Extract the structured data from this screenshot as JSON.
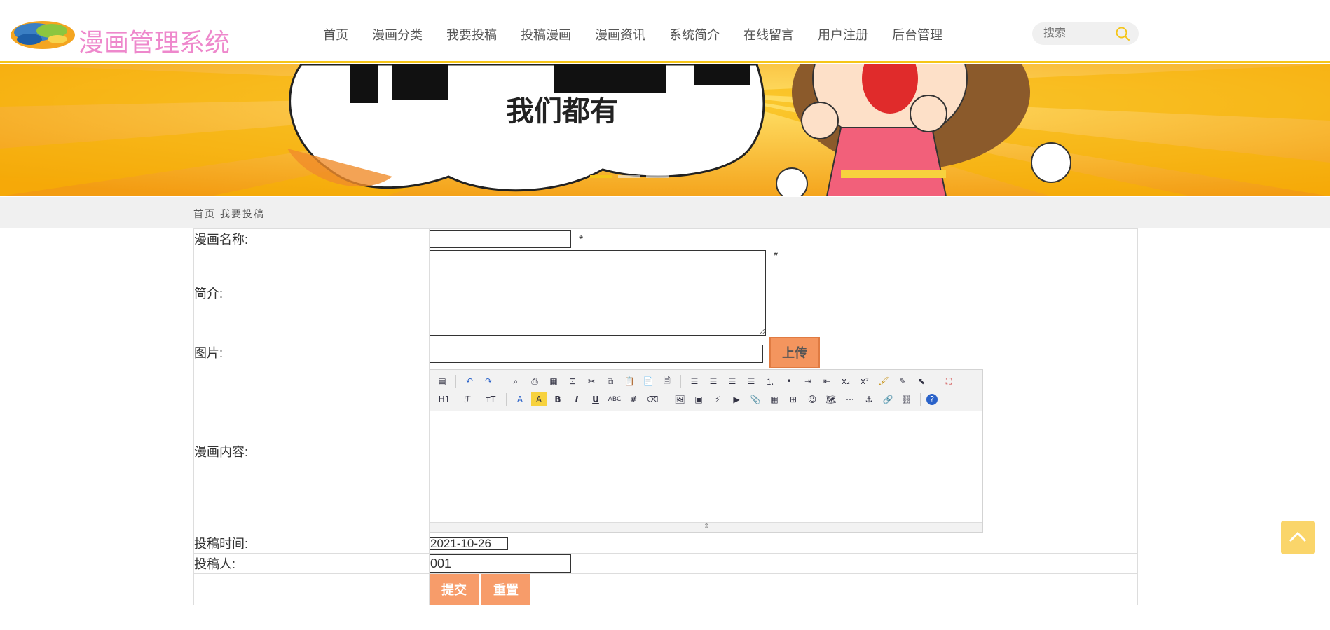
{
  "app": {
    "title": "漫画管理系统"
  },
  "nav": {
    "items": [
      "首页",
      "漫画分类",
      "我要投稿",
      "投稿漫画",
      "漫画资讯",
      "系统简介",
      "在线留言",
      "用户注册",
      "后台管理"
    ]
  },
  "search": {
    "placeholder": "搜索"
  },
  "banner": {
    "caption": "我们都有",
    "active_slide": 1,
    "slide_count": 3
  },
  "breadcrumb": [
    "首页",
    "我要投稿"
  ],
  "form": {
    "name_label": "漫画名称:",
    "name_value": "",
    "required_mark": "*",
    "intro_label": "简介:",
    "intro_value": "",
    "image_label": "图片:",
    "image_value": "",
    "upload_label": "上传",
    "content_label": "漫画内容:",
    "time_label": "投稿时间:",
    "time_value": "2021-10-26",
    "author_label": "投稿人:",
    "author_value": "001",
    "submit_label": "提交",
    "reset_label": "重置"
  },
  "editor": {
    "row2_heading": "H1",
    "row2_font": "ℱ",
    "row2_size": "ᴛT"
  },
  "colors": {
    "accent": "#f5c518",
    "brand": "#ee88cc",
    "button": "#f79c6a"
  }
}
